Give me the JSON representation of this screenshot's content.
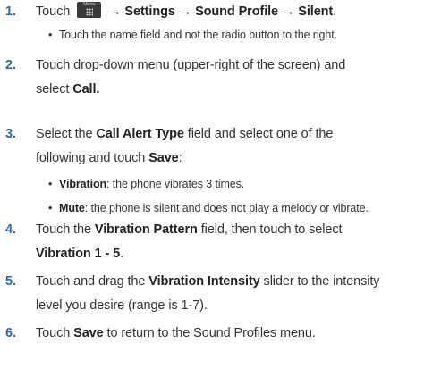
{
  "steps": [
    {
      "num": "1.",
      "before_icon": "Touch",
      "icon_label": "Menu",
      "icon": "menu-icon",
      "path": "→ Settings → Sound Profile → Silent",
      "tail": ".",
      "sub": [
        "Touch the name field and not the radio button to the right."
      ]
    },
    {
      "num": "2.",
      "line1": "Touch drop-down menu (upper-right of the screen) and",
      "line2_pre": "select ",
      "line2_bold": "Call."
    },
    {
      "num": "3.",
      "line1_pre": "Select the ",
      "line1_bold": "Call Alert Type",
      "line1_post": " field and select one of the",
      "line2_pre": "following and touch ",
      "line2_bold": "Save",
      "line2_post": ":",
      "bullets": [
        {
          "bold": "Vibration",
          "text": ": the phone vibrates 3 times."
        },
        {
          "bold": "Mute",
          "text": ": the phone is silent and does not play a melody or vibrate."
        }
      ]
    },
    {
      "num": "4.",
      "line1_pre": "Touch the ",
      "line1_bold": "Vibration Pattern",
      "line1_post": " field, then touch to select",
      "line2_bold": "Vibration 1 - 5",
      "line2_post": "."
    },
    {
      "num": "5.",
      "line1_pre": "Touch and drag the ",
      "line1_bold": "Vibration Intensity",
      "line1_post": " slider to the intensity",
      "line2": "level you desire (range is 1-7)."
    },
    {
      "num": "6.",
      "line1_pre": "Touch ",
      "line1_bold": "Save",
      "line1_post": " to return to the Sound Profiles menu."
    }
  ],
  "colors": {
    "step_number": "#2a6aa8",
    "text": "#333333"
  }
}
